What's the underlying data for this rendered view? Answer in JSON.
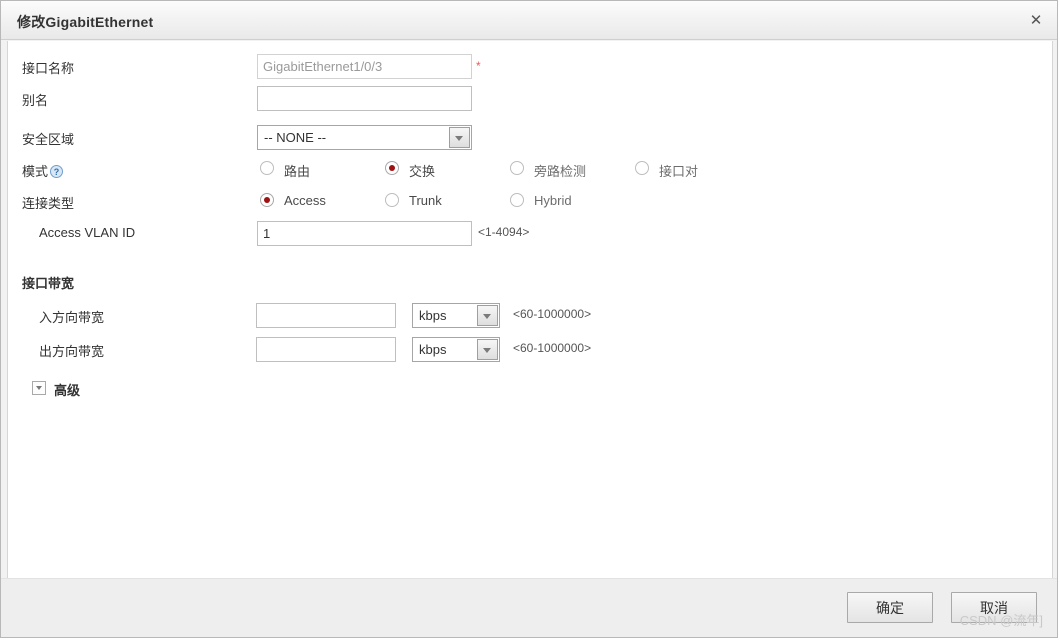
{
  "window": {
    "title": "修改GigabitEthernet",
    "close_icon": "close-icon"
  },
  "form": {
    "interface_name": {
      "label": "接口名称",
      "value": "GigabitEthernet1/0/3",
      "required_marker": "*"
    },
    "alias": {
      "label": "别名",
      "value": "",
      "placeholder": ""
    },
    "security_zone": {
      "label": "安全区域",
      "selected": "-- NONE --"
    },
    "mode": {
      "label": "模式",
      "help_icon": "?",
      "options": [
        {
          "label": "路由",
          "selected": false
        },
        {
          "label": "交换",
          "selected": true
        },
        {
          "label": "旁路检测",
          "selected": false
        },
        {
          "label": "接口对",
          "selected": false
        }
      ]
    },
    "link_type": {
      "label": "连接类型",
      "options": [
        {
          "label": "Access",
          "selected": true
        },
        {
          "label": "Trunk",
          "selected": false
        },
        {
          "label": "Hybrid",
          "selected": false
        }
      ]
    },
    "access_vlan": {
      "label": "Access VLAN ID",
      "value": "1",
      "hint": "<1-4094>"
    }
  },
  "bandwidth": {
    "section_title": "接口带宽",
    "inbound": {
      "label": "入方向带宽",
      "value": "",
      "unit": "kbps",
      "hint": "<60-1000000>"
    },
    "outbound": {
      "label": "出方向带宽",
      "value": "",
      "unit": "kbps",
      "hint": "<60-1000000>"
    }
  },
  "advanced": {
    "label": "高级",
    "expanded": false
  },
  "footer": {
    "ok_label": "确定",
    "cancel_label": "取消"
  },
  "watermark": "CSDN @流年]"
}
